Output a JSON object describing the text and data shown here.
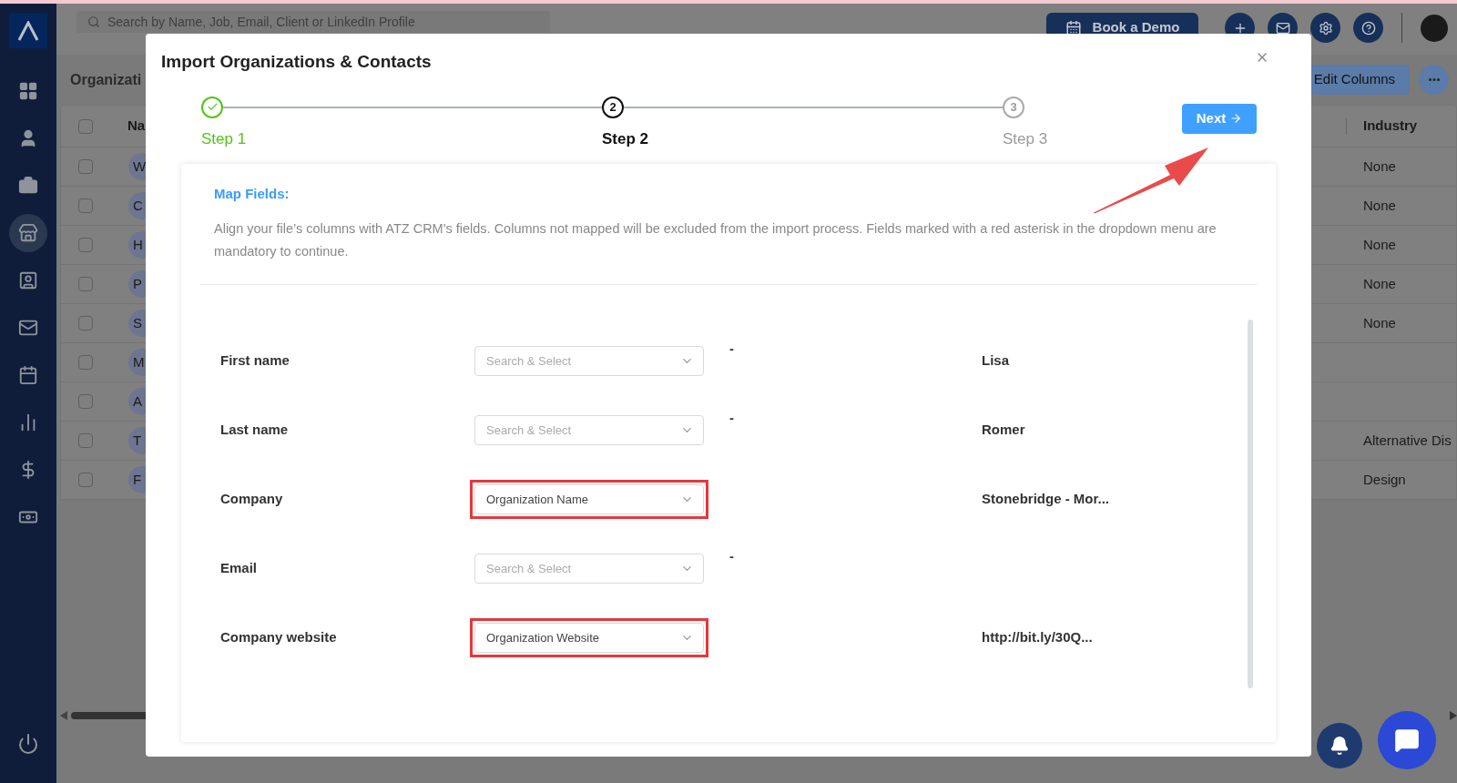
{
  "sidebar": {
    "items": [
      {
        "kind": "grid",
        "selected": false
      },
      {
        "kind": "person",
        "selected": false
      },
      {
        "kind": "briefcase",
        "selected": false
      },
      {
        "kind": "store",
        "selected": true
      },
      {
        "kind": "contact",
        "selected": false
      },
      {
        "kind": "mail",
        "selected": false
      },
      {
        "kind": "calendar",
        "selected": false
      },
      {
        "kind": "chart",
        "selected": false
      },
      {
        "kind": "dollar",
        "selected": false
      },
      {
        "kind": "cash",
        "selected": false
      }
    ]
  },
  "topbar": {
    "search": {
      "placeholder": "Search by Name, Job, Email, Client or LinkedIn Profile"
    },
    "book_demo": "Book a Demo"
  },
  "page": {
    "title": "Organizati",
    "edit_columns": "Edit Columns"
  },
  "table": {
    "all_checked": false,
    "columns": [
      "Na",
      "Industry"
    ],
    "rows": [
      {
        "checked": false,
        "initial": "W",
        "industry": "None"
      },
      {
        "checked": false,
        "initial": "C",
        "industry": "None"
      },
      {
        "checked": false,
        "initial": "H",
        "industry": "None"
      },
      {
        "checked": false,
        "initial": "P",
        "industry": "None"
      },
      {
        "checked": false,
        "initial": "S",
        "industry": "None"
      },
      {
        "checked": false,
        "initial": "M"
      },
      {
        "checked": false,
        "initial": "A"
      },
      {
        "checked": false,
        "initial": "T",
        "industry": "Alternative Dis"
      },
      {
        "checked": false,
        "initial": "F",
        "industry": "Design"
      }
    ]
  },
  "modal": {
    "title": "Import Organizations & Contacts",
    "steps": [
      {
        "label": "Step 1",
        "done": true,
        "selected": false
      },
      {
        "label": "Step 2",
        "number": "2",
        "done": false,
        "selected": true
      },
      {
        "label": "Step 3",
        "number": "3",
        "done": false,
        "selected": false
      }
    ],
    "next": "Next",
    "section_title": "Map Fields:",
    "description": "Align your file’s columns with ATZ CRM's fields. Columns not mapped will be excluded from the import process. Fields marked with a red asterisk in the dropdown menu are mandatory to continue.",
    "fields": [
      {
        "label": "First name",
        "placeholder": "Search & Select",
        "highlighted": false,
        "mark": "-",
        "sample": "Lisa"
      },
      {
        "label": "Last name",
        "placeholder": "Search & Select",
        "highlighted": false,
        "mark": "-",
        "sample": "Romer"
      },
      {
        "label": "Company",
        "value": "Organization Name",
        "highlighted": true,
        "sample": "Stonebridge - Mor..."
      },
      {
        "label": "Email",
        "placeholder": "Search & Select",
        "highlighted": false,
        "mark": "-"
      },
      {
        "label": "Company website",
        "value": "Organization Website",
        "highlighted": true,
        "sample": "http://bit.ly/30Q..."
      }
    ]
  }
}
